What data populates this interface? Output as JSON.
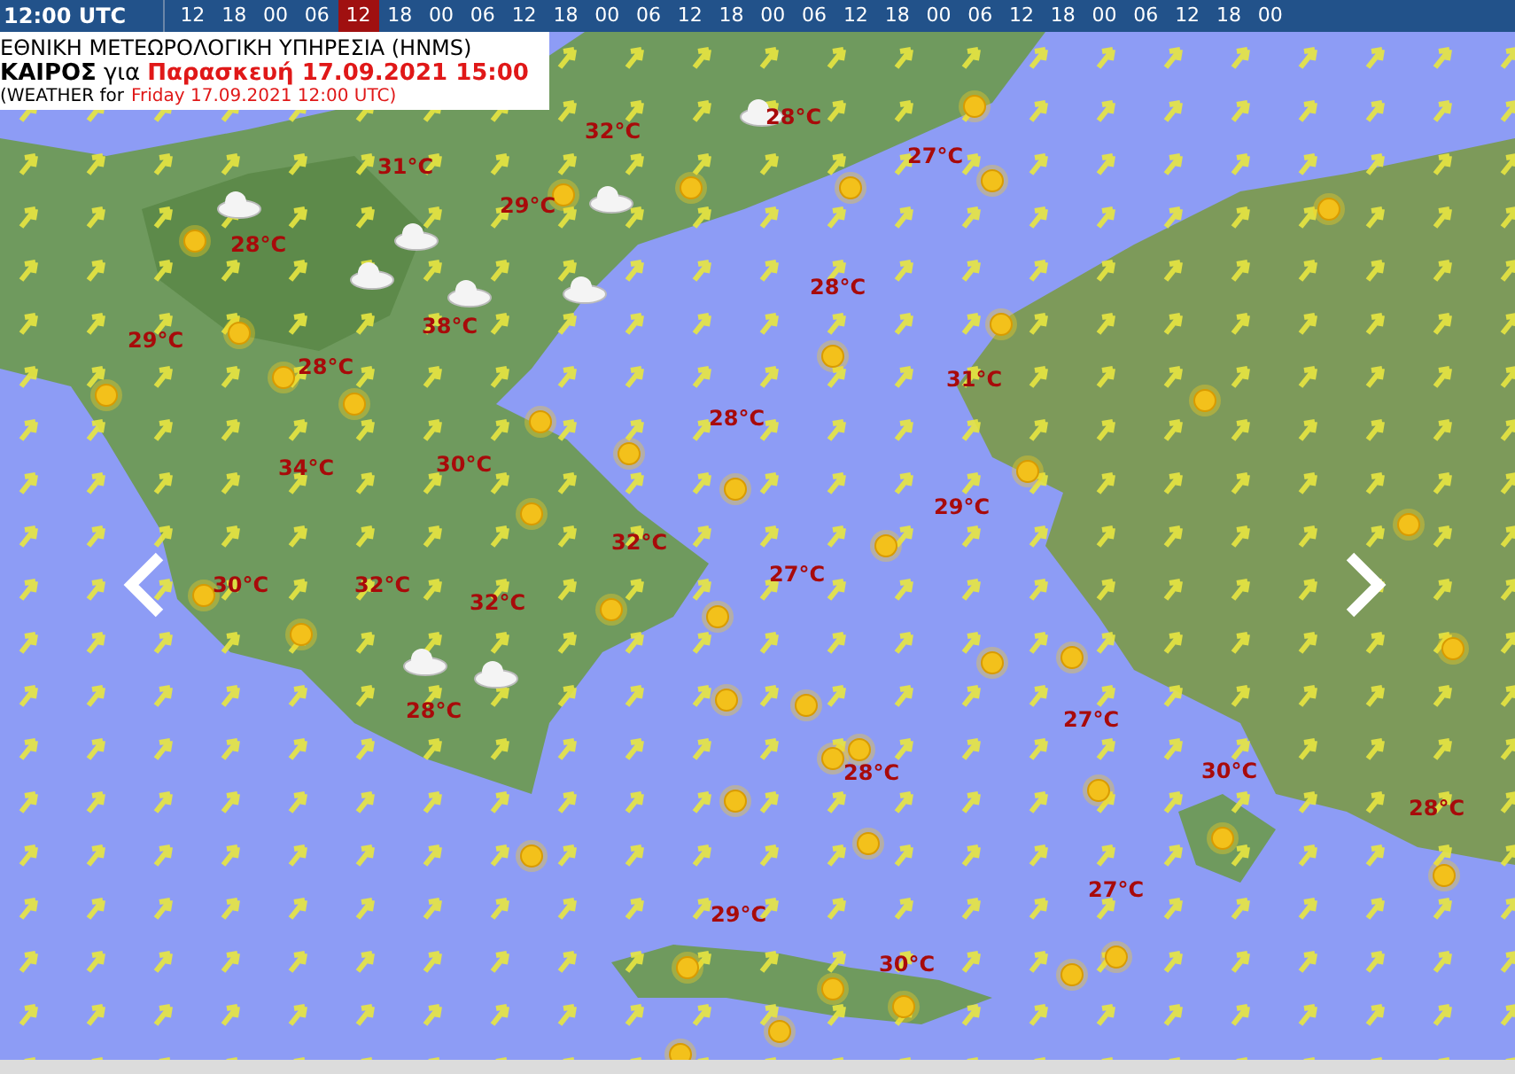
{
  "timebar": {
    "current": "12:00 UTC",
    "hours": [
      {
        "label": "12",
        "selected": false
      },
      {
        "label": "18",
        "selected": false
      },
      {
        "label": "00",
        "selected": false
      },
      {
        "label": "06",
        "selected": false
      },
      {
        "label": "12",
        "selected": true
      },
      {
        "label": "18",
        "selected": false
      },
      {
        "label": "00",
        "selected": false
      },
      {
        "label": "06",
        "selected": false
      },
      {
        "label": "12",
        "selected": false
      },
      {
        "label": "18",
        "selected": false
      },
      {
        "label": "00",
        "selected": false
      },
      {
        "label": "06",
        "selected": false
      },
      {
        "label": "12",
        "selected": false
      },
      {
        "label": "18",
        "selected": false
      },
      {
        "label": "00",
        "selected": false
      },
      {
        "label": "06",
        "selected": false
      },
      {
        "label": "12",
        "selected": false
      },
      {
        "label": "18",
        "selected": false
      },
      {
        "label": "00",
        "selected": false
      },
      {
        "label": "06",
        "selected": false
      },
      {
        "label": "12",
        "selected": false
      },
      {
        "label": "18",
        "selected": false
      },
      {
        "label": "00",
        "selected": false
      },
      {
        "label": "06",
        "selected": false
      },
      {
        "label": "12",
        "selected": false
      },
      {
        "label": "18",
        "selected": false
      },
      {
        "label": "00",
        "selected": false
      }
    ]
  },
  "header": {
    "agency": "ΕΘΝΙΚΗ ΜΕΤΕΩΡΟΛΟΓΙΚΗ ΥΠΗΡΕΣΙΑ (HNMS)",
    "weather_label": "ΚΑΙΡΟΣ",
    "for_word": "για",
    "forecast_time": "Παρασκευή 17.09.2021 15:00",
    "subtitle_prefix": "(WEATHER for",
    "subtitle_time": "Friday 17.09.2021 12:00 UTC)"
  },
  "map": {
    "temperatures": [
      "32°C",
      "28°C",
      "27°C",
      "31°C",
      "29°C",
      "28°C",
      "28°C",
      "38°C",
      "29°C",
      "28°C",
      "31°C",
      "28°C",
      "34°C",
      "30°C",
      "29°C",
      "32°C",
      "30°C",
      "32°C",
      "27°C",
      "32°C",
      "28°C",
      "27°C",
      "30°C",
      "28°C",
      "28°C",
      "27°C",
      "29°C",
      "30°C"
    ]
  }
}
